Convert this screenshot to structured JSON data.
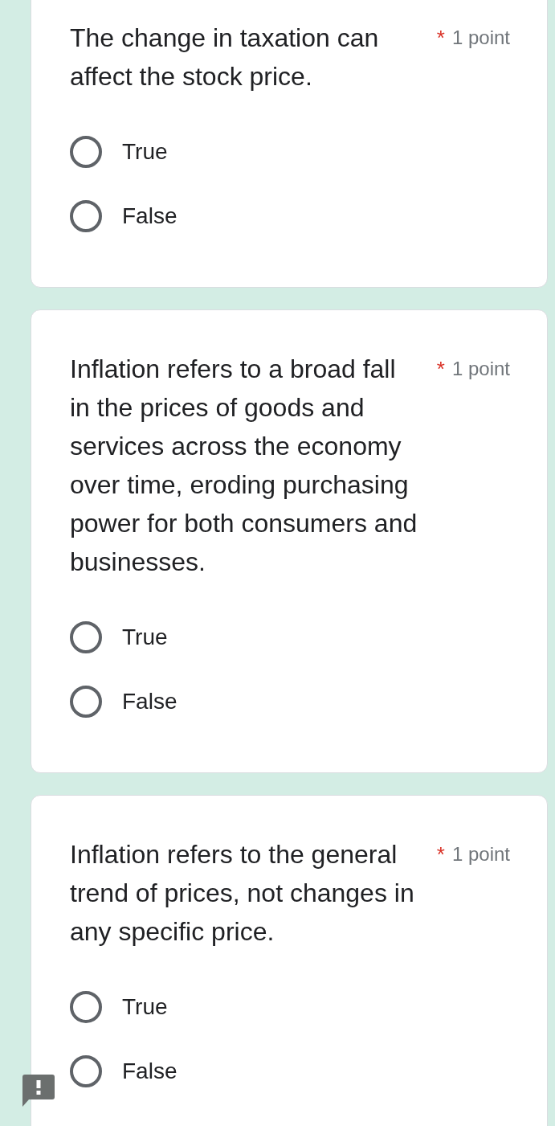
{
  "questions": [
    {
      "text": "The change in taxation can affect the stock price.",
      "required_mark": "*",
      "points": "1 point",
      "options": [
        {
          "label": "True",
          "selected": false
        },
        {
          "label": "False",
          "selected": false
        }
      ]
    },
    {
      "text": "Inflation refers to a broad fall in the prices of goods and services across the economy over time, eroding purchasing power for both consumers and businesses.",
      "required_mark": "*",
      "points": "1 point",
      "options": [
        {
          "label": "True",
          "selected": false
        },
        {
          "label": "False",
          "selected": false
        }
      ]
    },
    {
      "text": "Inflation refers to the general trend of prices, not changes in any specific price.",
      "required_mark": "*",
      "points": "1 point",
      "options": [
        {
          "label": "True",
          "selected": false
        },
        {
          "label": "False",
          "selected": false
        }
      ]
    }
  ]
}
